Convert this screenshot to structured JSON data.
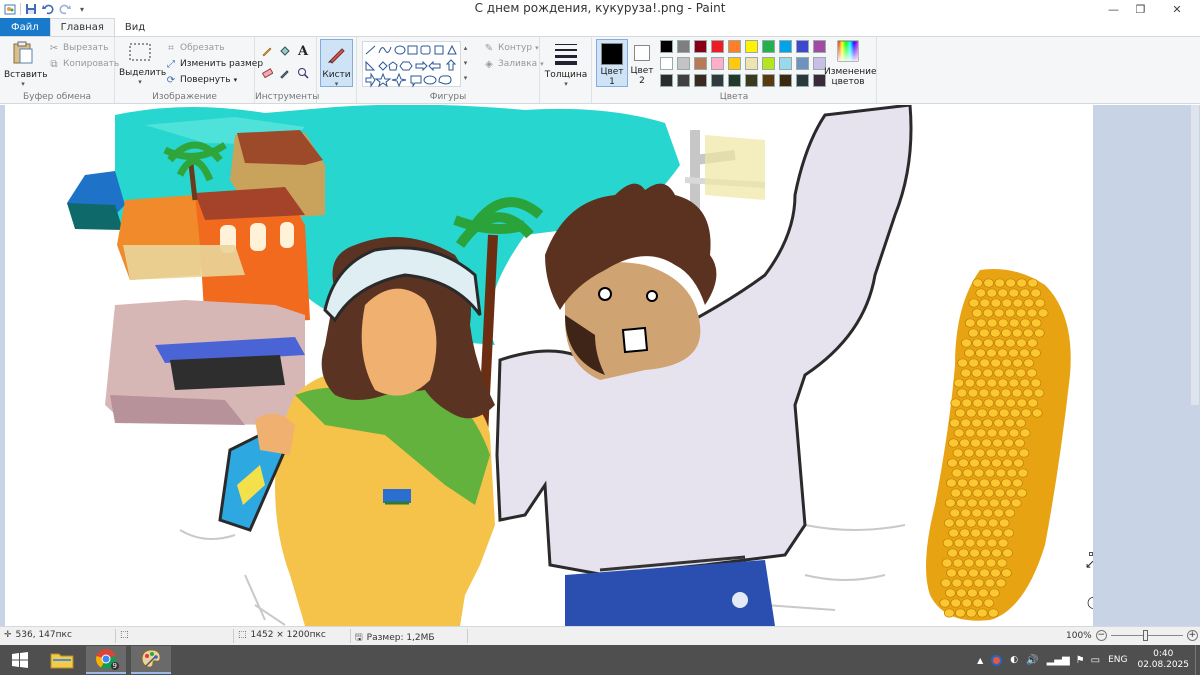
{
  "window": {
    "title": "С днем рождения, кукуруза!.png - Paint"
  },
  "tabs": [
    "Файл",
    "Главная",
    "Вид"
  ],
  "ribbon": {
    "clipboard": {
      "label": "Буфер обмена",
      "paste": "Вставить",
      "cut": "Вырезать",
      "copy": "Копировать"
    },
    "image": {
      "label": "Изображение",
      "select": "Выделить",
      "crop": "Обрезать",
      "resize": "Изменить размер",
      "rotate": "Повернуть"
    },
    "tools": {
      "label": "Инструменты"
    },
    "brushes": {
      "label": "Кисти"
    },
    "shapes": {
      "label": "Фигуры",
      "outline": "Контур",
      "fill": "Заливка"
    },
    "size": {
      "label": "Толщина"
    },
    "colors": {
      "label": "Цвета",
      "color1": "Цвет",
      "color1_num": "1",
      "color2": "Цвет",
      "color2_num": "2",
      "edit": "Изменение цветов",
      "color1_value": "#000000",
      "color2_value": "#ffffff",
      "palette_row1": [
        "#000000",
        "#7f7f7f",
        "#880015",
        "#ed1c24",
        "#ff7f27",
        "#fff200",
        "#22b14c",
        "#00a2e8",
        "#3f48cc",
        "#a349a4"
      ],
      "palette_row2": [
        "#ffffff",
        "#c3c3c3",
        "#b97a57",
        "#ffaec9",
        "#ffc90e",
        "#efe4b0",
        "#b5e61d",
        "#99d9ea",
        "#7092be",
        "#c8bfe7"
      ],
      "palette_row3": [
        "#303030",
        "#303030",
        "#303030",
        "#303030",
        "#303030",
        "#303030",
        "#303030",
        "#303030",
        "#303030",
        "#303030"
      ]
    }
  },
  "status": {
    "cursor": "536, 147пкс",
    "image_size": "1452 × 1200пкс",
    "file_size": "Размер: 1,2МБ",
    "zoom": "100%"
  },
  "taskbar": {
    "chrome_badge": "9",
    "lang": "ENG",
    "time": "0:40",
    "date": "02.08.2025"
  }
}
